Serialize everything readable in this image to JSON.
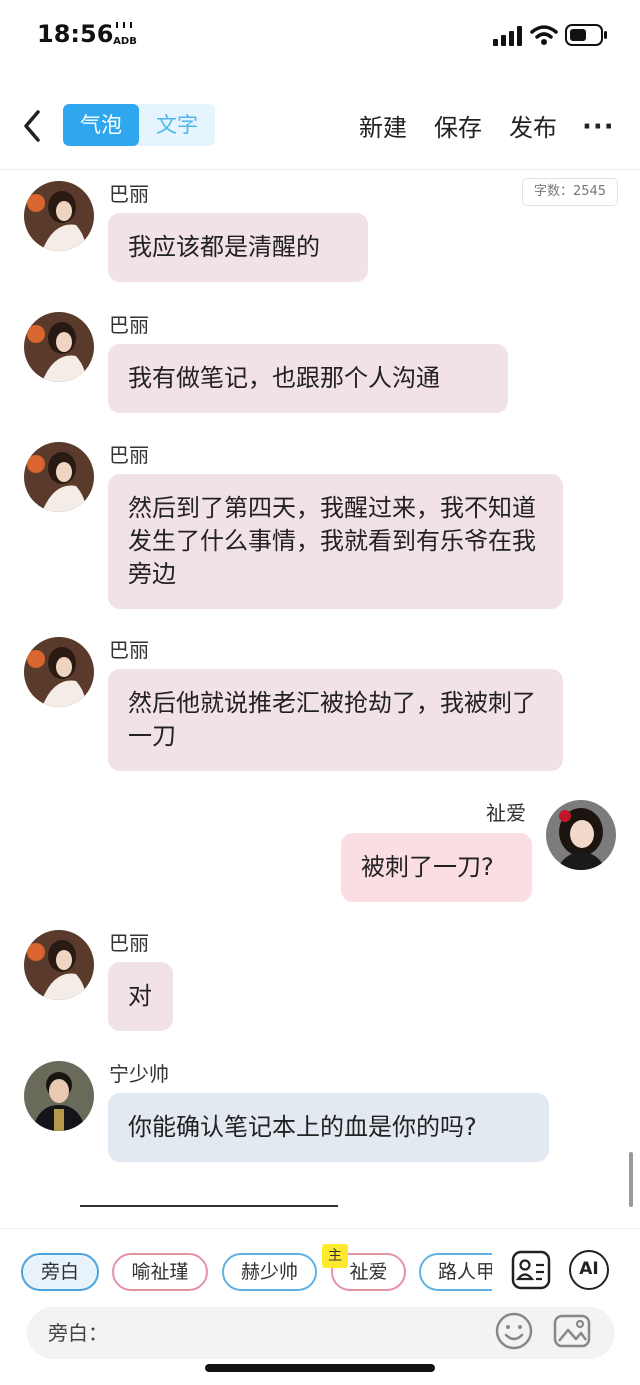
{
  "status_bar": {
    "time": "18:56",
    "adb_label": "ADB"
  },
  "nav": {
    "back_icon": "chevron-left-icon",
    "tabs": [
      {
        "label": "气泡",
        "active": true
      },
      {
        "label": "文字",
        "active": false
      }
    ],
    "actions": [
      "新建",
      "保存",
      "发布"
    ],
    "more_icon": "more-dots-icon"
  },
  "word_count": "字数：2545",
  "messages": [
    {
      "sender": "巴丽",
      "text": "我应该都是清醒的",
      "side": "left"
    },
    {
      "sender": "巴丽",
      "text": "我有做笔记，也跟那个人沟通",
      "side": "left"
    },
    {
      "sender": "巴丽",
      "text": "然后到了第四天，我醒过来，我不知道发生了什么事情，我就看到有乐爷在我旁边",
      "side": "left"
    },
    {
      "sender": "巴丽",
      "text": "然后他就说推老汇被抢劫了，我被刺了一刀",
      "side": "left"
    },
    {
      "sender": "祉爱",
      "text": "被刺了一刀?",
      "side": "right"
    },
    {
      "sender": "巴丽",
      "text": "对",
      "side": "left"
    },
    {
      "sender": "宁少帅",
      "text": "你能确认笔记本上的血是你的吗?",
      "side": "left"
    }
  ],
  "roles": [
    {
      "label": "旁白"
    },
    {
      "label": "喻祉瑾"
    },
    {
      "label": "赫少帅"
    },
    {
      "label": "祉爱",
      "tag": "主"
    },
    {
      "label": "路人甲"
    }
  ],
  "input": {
    "label": "旁白："
  },
  "icons": {
    "role_card": "role-card-icon",
    "ai": "AI",
    "emoji": "emoji-icon",
    "image": "image-icon"
  },
  "colors": {
    "accent": "#2fa6ee",
    "bubble_left": "#f1e2e5",
    "bubble_right": "#fbdde4",
    "bubble_blue": "#e3e9f1"
  }
}
